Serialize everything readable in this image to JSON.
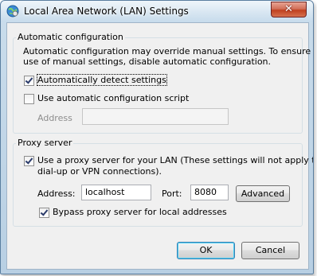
{
  "window": {
    "title": "Local Area Network (LAN) Settings",
    "close_symbol": "✕"
  },
  "auto_config": {
    "legend": "Automatic configuration",
    "description_line1": "Automatic configuration may override manual settings.  To ensure the",
    "description_line2": "use of manual settings, disable automatic configuration.",
    "detect_label": "Automatically detect settings",
    "detect_checked": true,
    "script_label": "Use automatic configuration script",
    "script_checked": false,
    "address_label": "Address",
    "address_value": ""
  },
  "proxy": {
    "legend": "Proxy server",
    "use_proxy_label_line1": "Use a proxy server for your LAN (These settings will not apply to",
    "use_proxy_label_line2": "dial-up or VPN connections).",
    "use_proxy_checked": true,
    "address_label": "Address:",
    "address_value": "localhost",
    "port_label": "Port:",
    "port_value": "8080",
    "advanced_label": "Advanced",
    "bypass_label": "Bypass proxy server for local addresses",
    "bypass_checked": true
  },
  "buttons": {
    "ok": "OK",
    "cancel": "Cancel"
  },
  "icons": {
    "title": "network-globe-icon",
    "close": "close-icon"
  },
  "colors": {
    "titlebar": "#c9dceb",
    "close_button": "#c0401f",
    "dialog_background": "#f0f0f0",
    "default_button_border": "#3c7fb1"
  }
}
